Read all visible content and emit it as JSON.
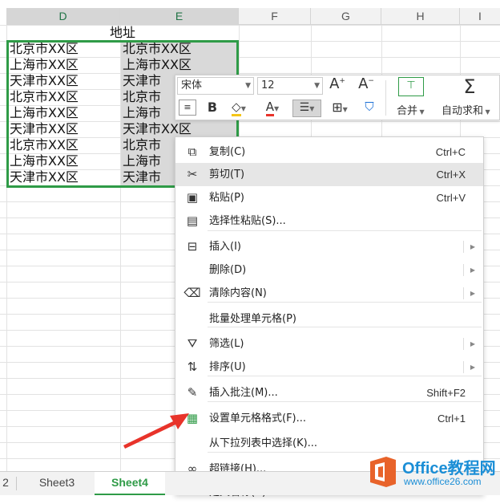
{
  "columns": {
    "D": "D",
    "E": "E",
    "F": "F",
    "G": "G",
    "H": "H",
    "I": "I"
  },
  "cells": {
    "header": "地址",
    "col_d": [
      "北京市XX区",
      "上海市XX区",
      "天津市XX区",
      "北京市XX区",
      "上海市XX区",
      "天津市XX区",
      "北京市XX区",
      "上海市XX区",
      "天津市XX区"
    ],
    "col_e": [
      "北京市XX区",
      "上海市XX区",
      "天津市",
      "北京市",
      "上海市",
      "天津市XX区",
      "北京市",
      "上海市",
      "天津市"
    ]
  },
  "mini_toolbar": {
    "font_name": "宋体",
    "font_size": "12",
    "merge_label": "合并",
    "autosum_label": "自动求和"
  },
  "context_menu": {
    "items": [
      {
        "label": "复制(C)",
        "shortcut": "Ctrl+C",
        "icon": "copy-icon"
      },
      {
        "label": "剪切(T)",
        "shortcut": "Ctrl+X",
        "icon": "scissors-icon"
      },
      {
        "label": "粘贴(P)",
        "shortcut": "Ctrl+V",
        "icon": "paste-icon"
      },
      {
        "label": "选择性粘贴(S)...",
        "shortcut": "",
        "icon": "paste-special-icon"
      },
      {
        "label": "插入(I)",
        "shortcut": "",
        "icon": "insert-icon"
      },
      {
        "label": "删除(D)",
        "shortcut": "",
        "icon": ""
      },
      {
        "label": "清除内容(N)",
        "shortcut": "",
        "icon": "eraser-icon"
      },
      {
        "label": "批量处理单元格(P)",
        "shortcut": "",
        "icon": ""
      },
      {
        "label": "筛选(L)",
        "shortcut": "",
        "icon": "filter-icon"
      },
      {
        "label": "排序(U)",
        "shortcut": "",
        "icon": "sort-icon"
      },
      {
        "label": "插入批注(M)...",
        "shortcut": "Shift+F2",
        "icon": "comment-icon"
      },
      {
        "label": "设置单元格格式(F)...",
        "shortcut": "Ctrl+1",
        "icon": "format-cells-icon"
      },
      {
        "label": "从下拉列表中选择(K)...",
        "shortcut": "",
        "icon": ""
      },
      {
        "label": "超链接(H)...",
        "shortcut": "",
        "icon": "link-icon"
      },
      {
        "label": "定义名称(A)...",
        "shortcut": "",
        "icon": ""
      }
    ]
  },
  "tabs": {
    "partial": "2",
    "sheet3": "Sheet3",
    "sheet4": "Sheet4"
  },
  "watermark": {
    "title": "Office教程网",
    "url": "www.office26.com"
  },
  "colors": {
    "accent": "#2f9b47",
    "arrow": "#e8332a",
    "watermark": "#1b8ed6"
  }
}
